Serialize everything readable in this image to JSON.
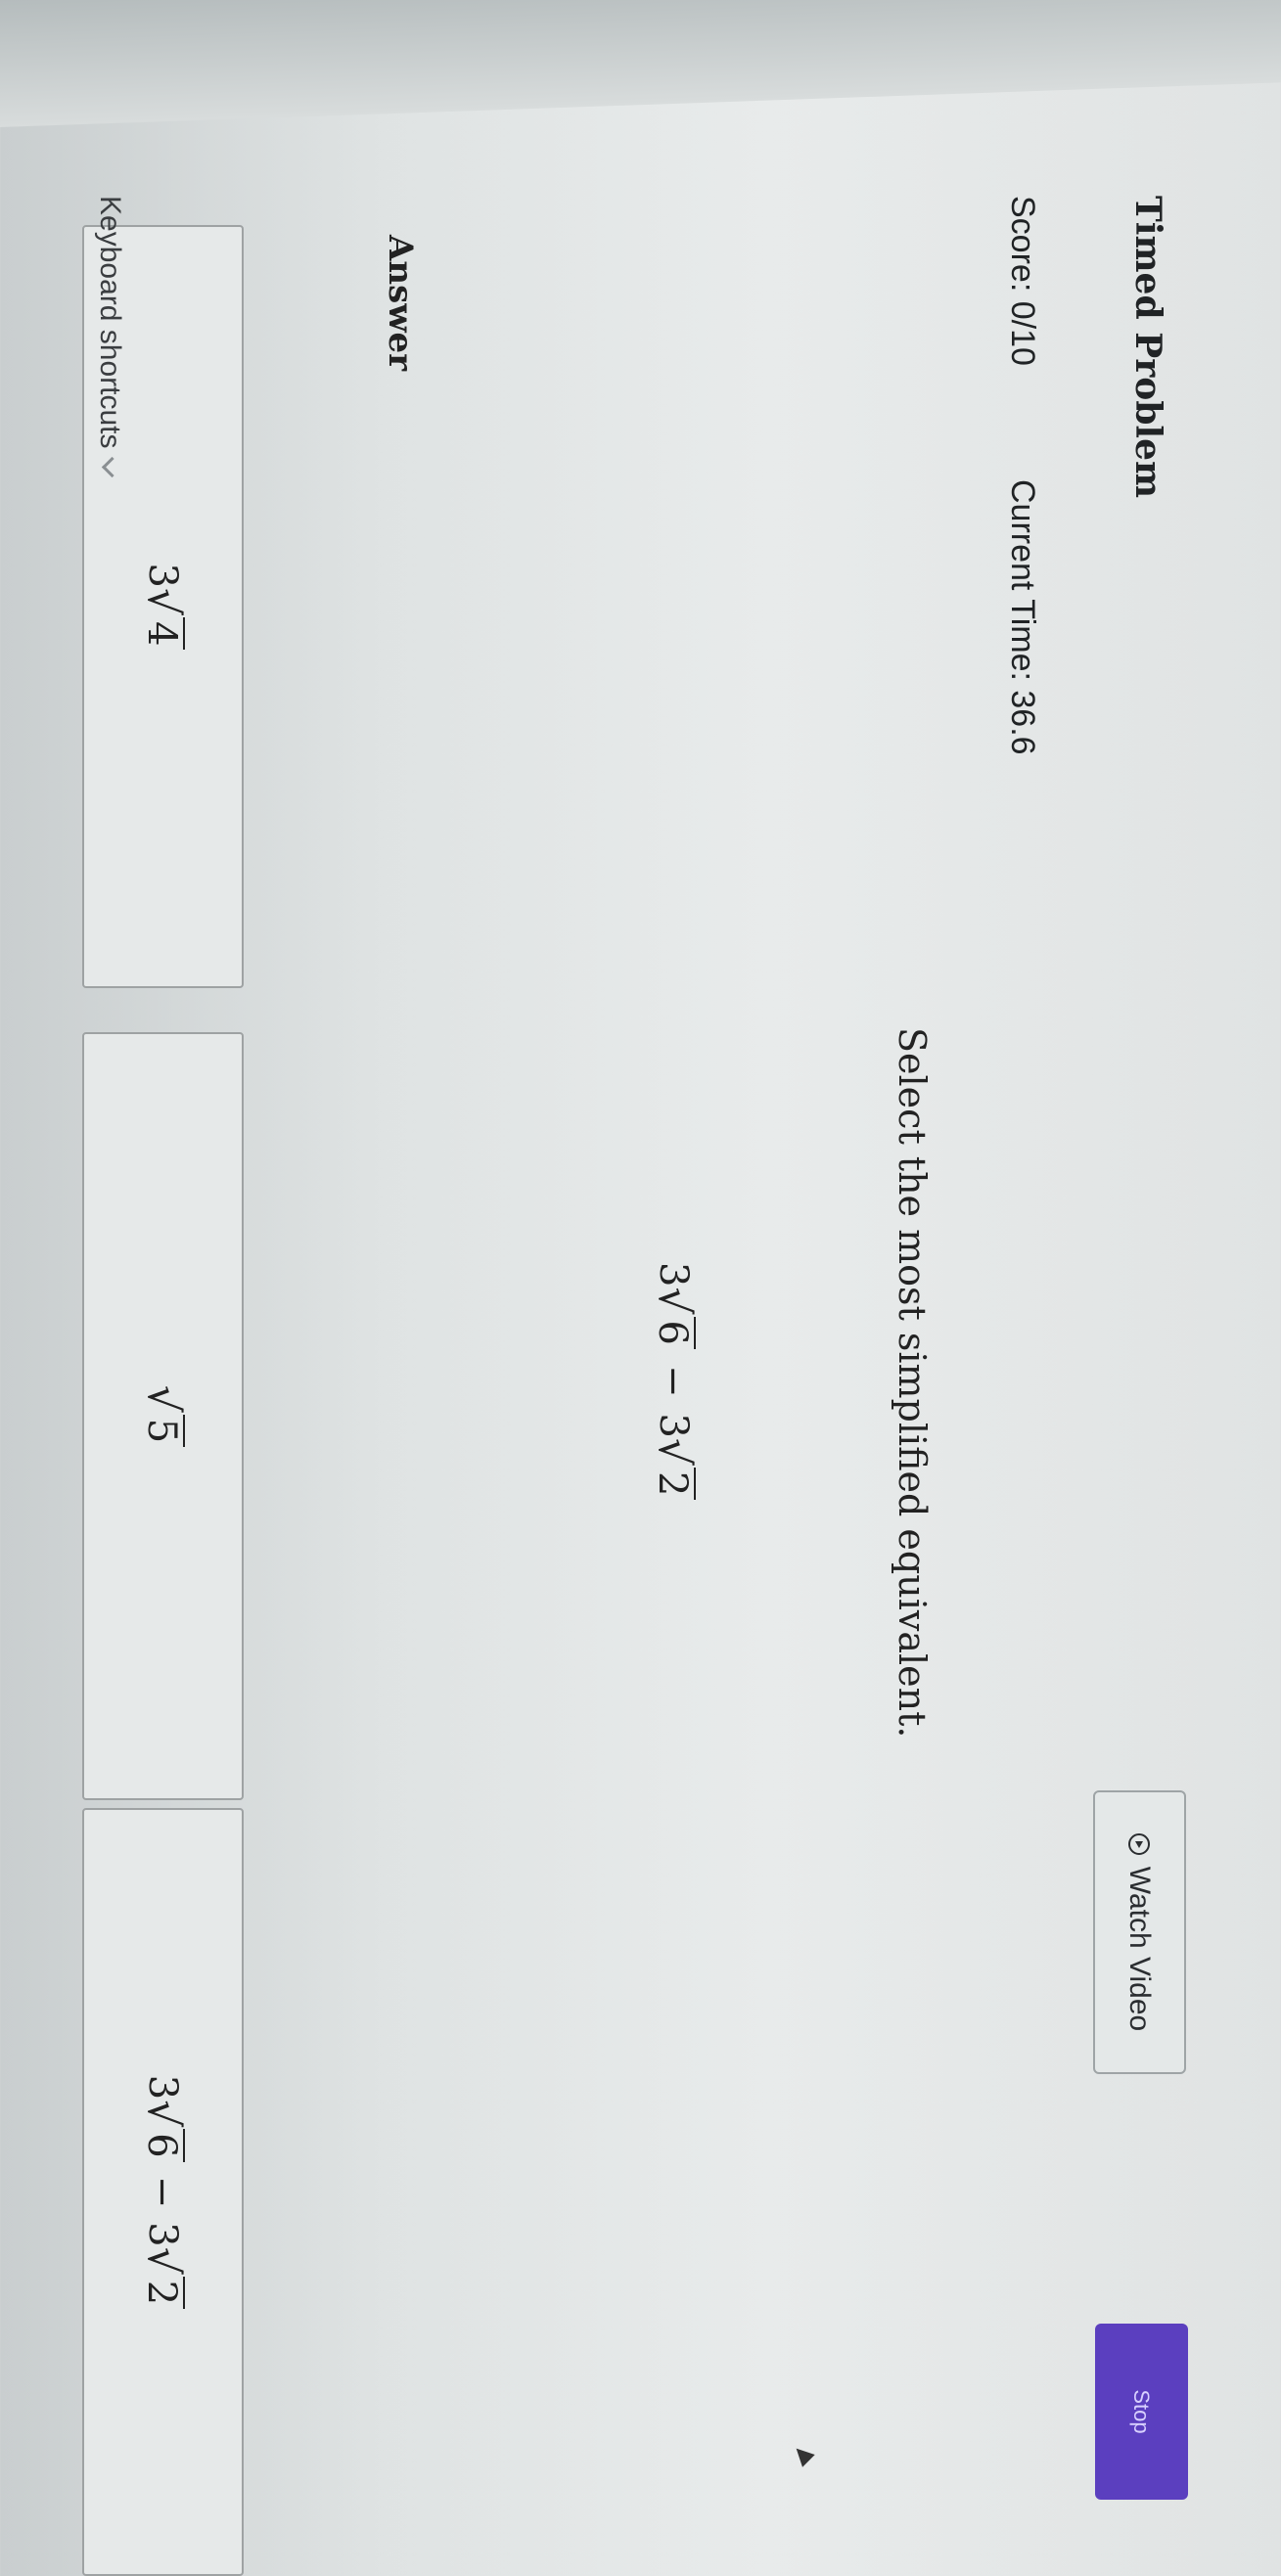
{
  "header": {
    "title": "Timed Problem",
    "watch_video_label": "Watch Video",
    "stop_label": "Stop",
    "score": "Score: 0/10",
    "current_time": "Current Time: 36.6"
  },
  "question": {
    "prompt": "Select the most simplified equivalent.",
    "expression": {
      "c1": "3",
      "r1": "6",
      "op": "−",
      "c2": "3",
      "r2": "2"
    }
  },
  "answer": {
    "label": "Answer",
    "choices": [
      {
        "coef": "3",
        "radicand": "4"
      },
      {
        "coef": "",
        "radicand": "5"
      },
      {
        "c1": "3",
        "r1": "6",
        "op": "−",
        "c2": "3",
        "r2": "2"
      }
    ]
  },
  "footer": {
    "shortcuts_label": "Keyboard shortcuts"
  },
  "colors": {
    "stop_button": "#5b3fbf",
    "background": "#e4e7e7"
  },
  "icons": [
    "play-circle-icon",
    "chevron-down-icon"
  ]
}
